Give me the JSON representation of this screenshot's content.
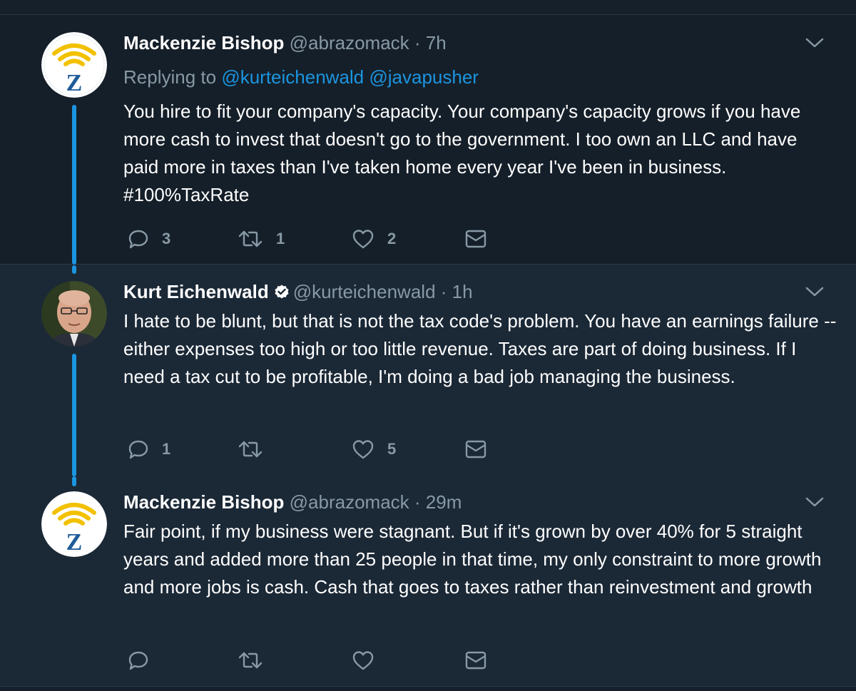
{
  "colors": {
    "background": "#1b2836",
    "highlighted_background": "#151f29",
    "accent": "#1b95e0",
    "muted": "#8899a6",
    "text": "#ffffff"
  },
  "tweets": [
    {
      "name": "Mackenzie Bishop",
      "handle": "@abrazomack",
      "separator": "·",
      "time": "7h",
      "avatar": "z-wifi-logo",
      "reply_prefix": "Replying to",
      "reply_mentions": [
        "@kurteichenwald",
        "@javapusher"
      ],
      "text": "You hire to fit your company's capacity. Your company's capacity grows if you have more cash to invest that doesn't go to the government. I too own an LLC and have paid more in taxes than I've taken home every year I've been in business. #100%TaxRate",
      "replies": "3",
      "retweets": "1",
      "likes": "2"
    },
    {
      "name": "Kurt Eichenwald",
      "verified": true,
      "handle": "@kurteichenwald",
      "separator": "·",
      "time": "1h",
      "avatar": "person-photo",
      "text": "I hate to be blunt, but that is not the tax code's problem. You have an earnings failure -- either expenses too high or too little revenue. Taxes are part of doing business. If I need a tax cut to be profitable, I'm doing a bad job managing the business.",
      "replies": "1",
      "retweets": "",
      "likes": "5"
    },
    {
      "name": "Mackenzie Bishop",
      "handle": "@abrazomack",
      "separator": "·",
      "time": "29m",
      "avatar": "z-wifi-logo",
      "text": "Fair point, if my business were stagnant. But if it's grown by over 40% for 5 straight years and added more than 25 people in that time, my only constraint to more growth and more jobs is cash. Cash that goes to taxes rather than reinvestment and growth",
      "replies": "",
      "retweets": "",
      "likes": ""
    }
  ]
}
